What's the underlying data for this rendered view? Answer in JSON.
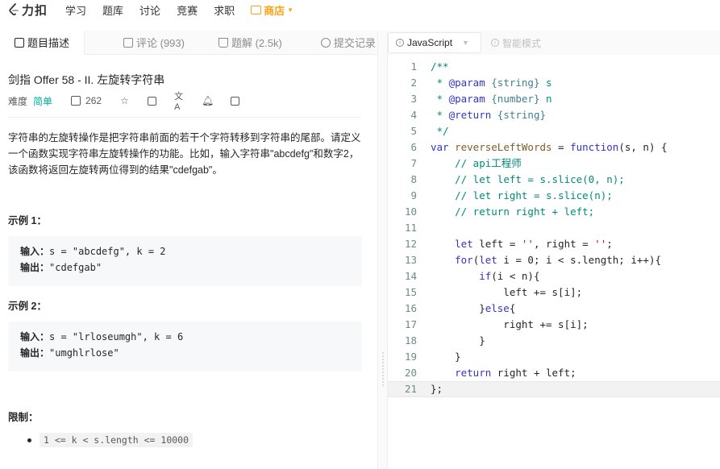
{
  "nav": {
    "logo_text": "力扣",
    "items": [
      "学习",
      "题库",
      "讨论",
      "竞赛",
      "求职"
    ],
    "store_label": "商店",
    "accent": "#ffa116"
  },
  "tabs": [
    {
      "label": "题目描述",
      "icon": "description-icon",
      "active": true
    },
    {
      "label": "评论 (993)",
      "icon": "comment-icon",
      "active": false
    },
    {
      "label": "题解 (2.5k)",
      "icon": "flask-icon",
      "active": false
    },
    {
      "label": "提交记录",
      "icon": "clock-icon",
      "active": false
    }
  ],
  "problem": {
    "title": "剑指 Offer 58 - II. 左旋转字符串",
    "difficulty_label": "难度",
    "difficulty": "简单",
    "difficulty_color": "#00af9b",
    "likes": "262",
    "description": "字符串的左旋转操作是把字符串前面的若干个字符转移到字符串的尾部。请定义一个函数实现字符串左旋转操作的功能。比如，输入字符串\"abcdefg\"和数字2，该函数将返回左旋转两位得到的结果\"cdefgab\"。",
    "examples": [
      {
        "label": "示例 1：",
        "input_key": "输入：",
        "input": "s = \"abcdefg\", k = 2",
        "output_key": "输出：",
        "output": "\"cdefgab\""
      },
      {
        "label": "示例 2：",
        "input_key": "输入：",
        "input": "s = \"lrloseumgh\", k = 6",
        "output_key": "输出：",
        "output": "\"umghlrlose\""
      }
    ],
    "limits_label": "限制：",
    "limits": [
      "1 <= k < s.length <= 10000"
    ]
  },
  "editor": {
    "language": "JavaScript",
    "smart_mode_label": "智能模式",
    "active_line": 21,
    "lines": [
      "/**",
      " * @param {string} s",
      " * @param {number} n",
      " * @return {string}",
      " */",
      "var reverseLeftWords = function(s, n) {",
      "    // api工程师",
      "    // let left = s.slice(0, n);",
      "    // let right = s.slice(n);",
      "    // return right + left;",
      "",
      "    let left = '', right = '';",
      "    for(let i = 0; i < s.length; i++){",
      "        if(i < n){",
      "            left += s[i];",
      "        }else{",
      "            right += s[i];",
      "        }",
      "    }",
      "    return right + left;",
      "};"
    ]
  }
}
